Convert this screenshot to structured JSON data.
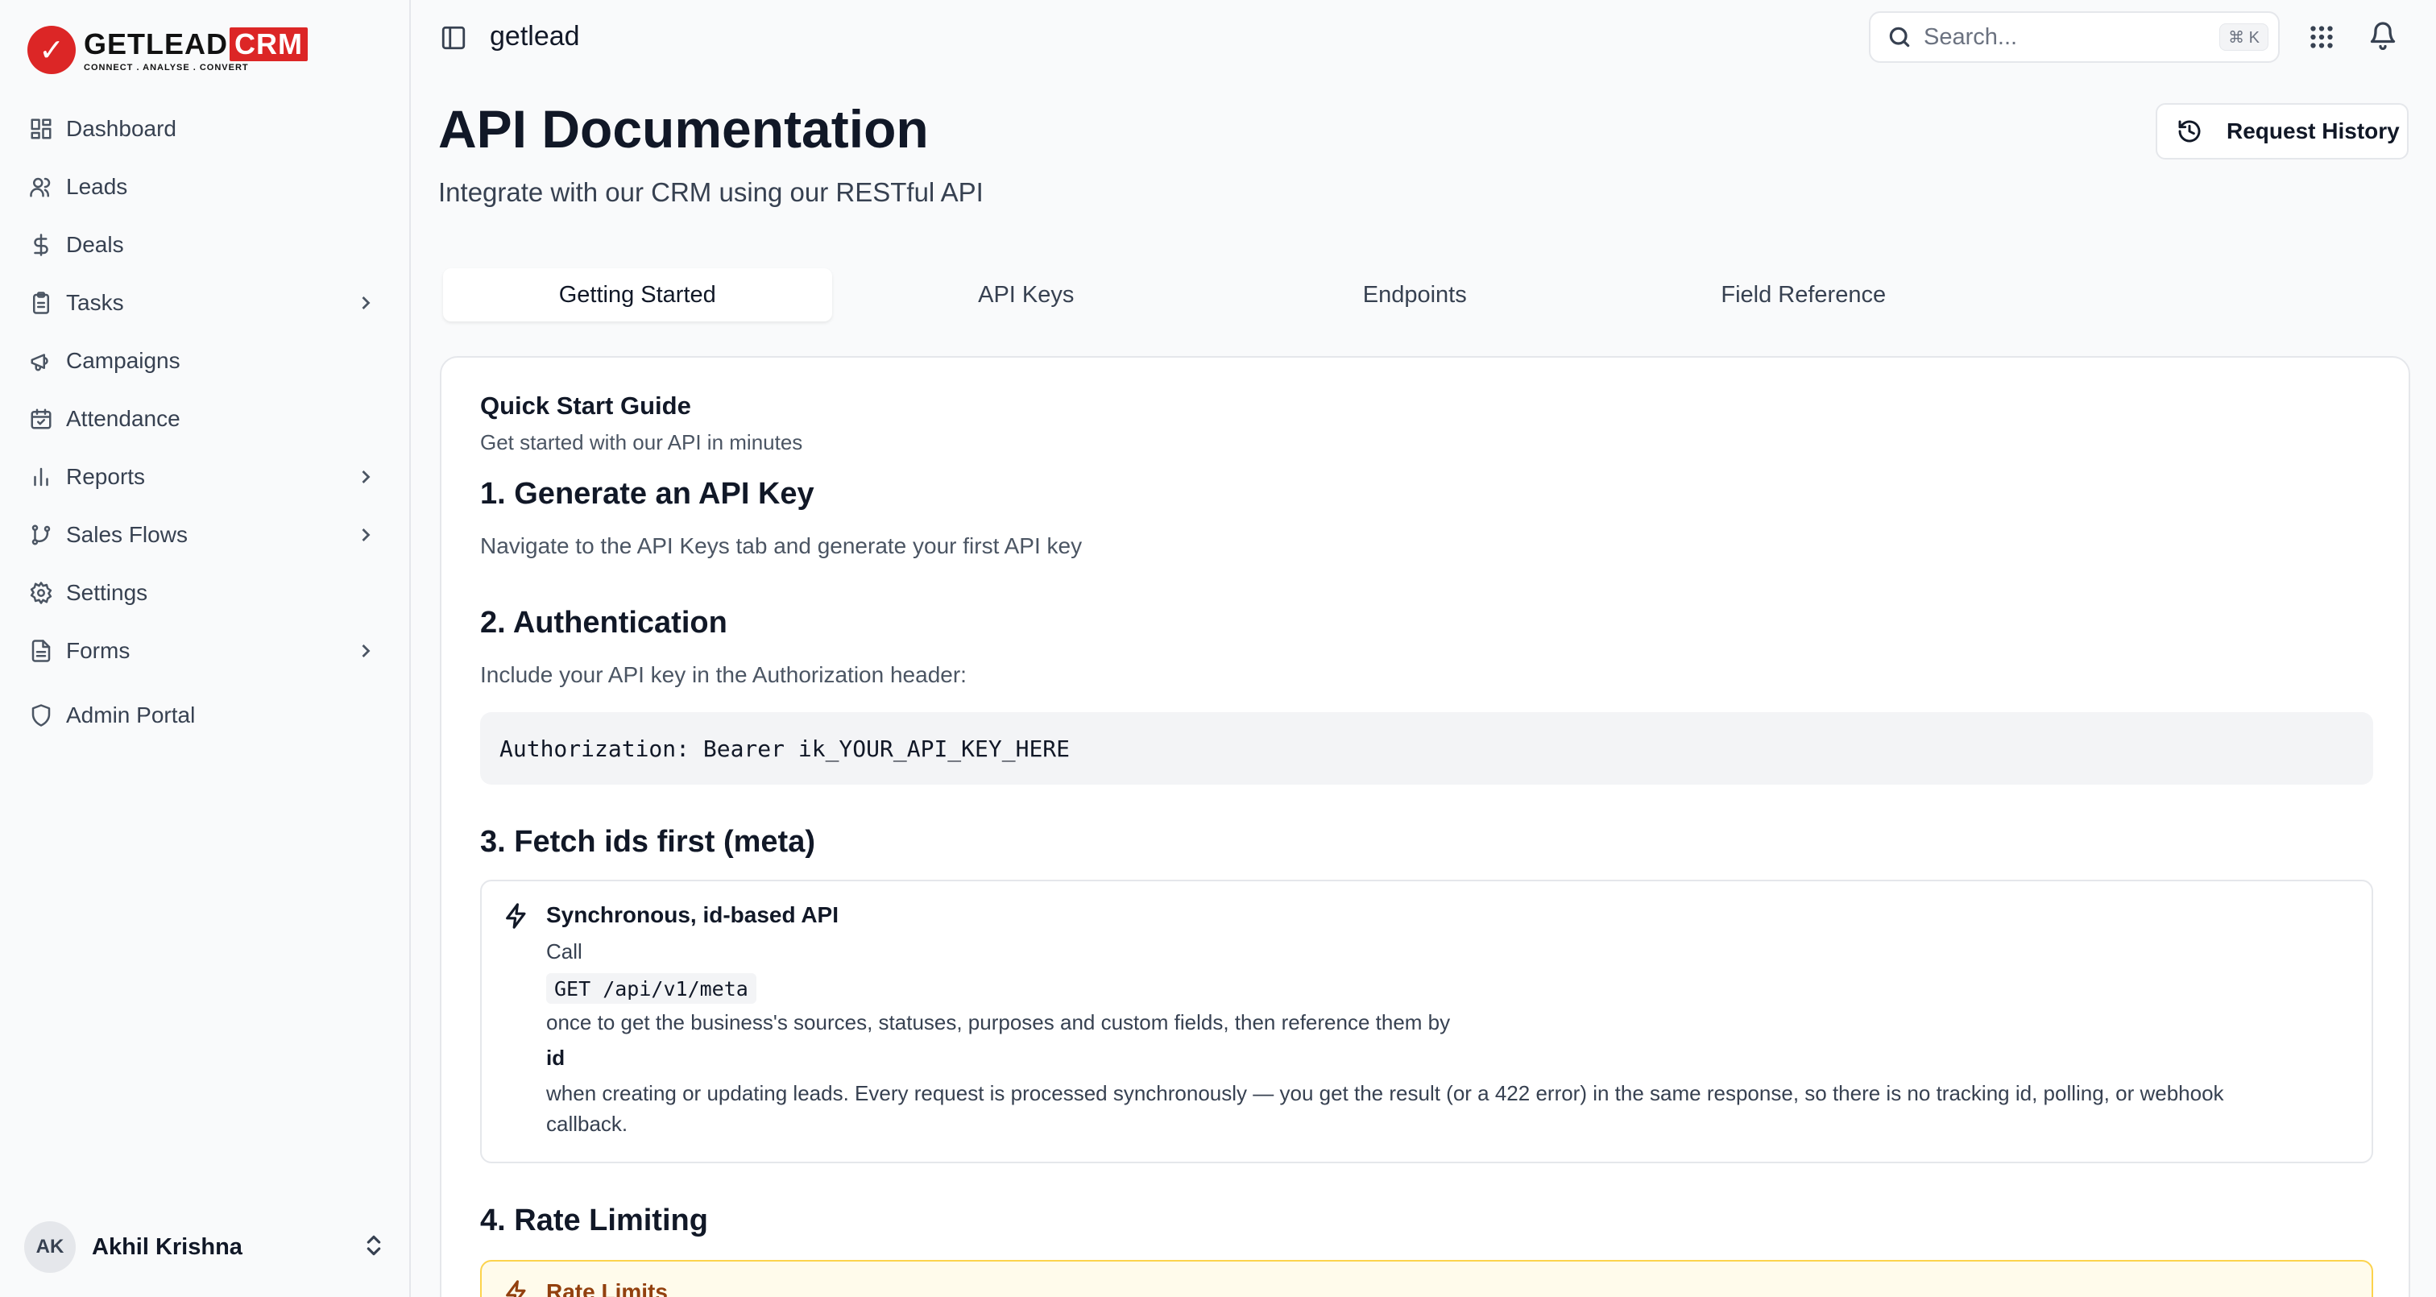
{
  "brand": {
    "name": "GETLEAD",
    "badge": "CRM",
    "tagline": "CONNECT . ANALYSE . CONVERT",
    "accent_color": "#dc2626"
  },
  "sidebar": {
    "items": [
      {
        "label": "Dashboard",
        "icon": "layout-grid-icon"
      },
      {
        "label": "Leads",
        "icon": "users-icon"
      },
      {
        "label": "Deals",
        "icon": "dollar-icon"
      },
      {
        "label": "Tasks",
        "icon": "clipboard-icon",
        "has_submenu": true
      },
      {
        "label": "Campaigns",
        "icon": "megaphone-icon"
      },
      {
        "label": "Attendance",
        "icon": "calendar-check-icon"
      },
      {
        "label": "Reports",
        "icon": "bar-chart-icon",
        "has_submenu": true
      },
      {
        "label": "Sales Flows",
        "icon": "git-branch-icon",
        "has_submenu": true
      },
      {
        "label": "Settings",
        "icon": "gear-icon"
      },
      {
        "label": "Forms",
        "icon": "file-text-icon",
        "has_submenu": true
      },
      {
        "label": "Admin Portal",
        "icon": "shield-icon"
      }
    ],
    "user": {
      "initials": "AK",
      "name": "Akhil Krishna"
    }
  },
  "topbar": {
    "workspace": "getlead",
    "search_placeholder": "Search...",
    "search_shortcut": "⌘ K"
  },
  "page": {
    "title": "API Documentation",
    "subtitle": "Integrate with our CRM using our RESTful API",
    "history_button": "Request History",
    "tabs": [
      {
        "label": "Getting Started",
        "active": true
      },
      {
        "label": "API Keys",
        "active": false
      },
      {
        "label": "Endpoints",
        "active": false
      },
      {
        "label": "Field Reference",
        "active": false
      }
    ]
  },
  "guide": {
    "title": "Quick Start Guide",
    "subtitle": "Get started with our API in minutes",
    "step1_title": "1. Generate an API Key",
    "step1_text": "Navigate to the API Keys tab and generate your first API key",
    "step2_title": "2. Authentication",
    "step2_text": "Include your API key in the Authorization header:",
    "step2_code": "Authorization: Bearer ik_YOUR_API_KEY_HERE",
    "step3_title": "3. Fetch ids first (meta)",
    "info": {
      "title": "Synchronous, id-based API",
      "line1": "Call",
      "code": "GET /api/v1/meta",
      "line2": "once to get the business's sources, statuses, purposes and custom fields, then reference them by",
      "bold": "id",
      "line3": "when creating or updating leads. Every request is processed synchronously — you get the result (or a 422 error) in the same response, so there is no tracking id, polling, or webhook",
      "line4": "callback."
    },
    "step4_title": "4. Rate Limiting",
    "rate_title": "Rate Limits"
  }
}
